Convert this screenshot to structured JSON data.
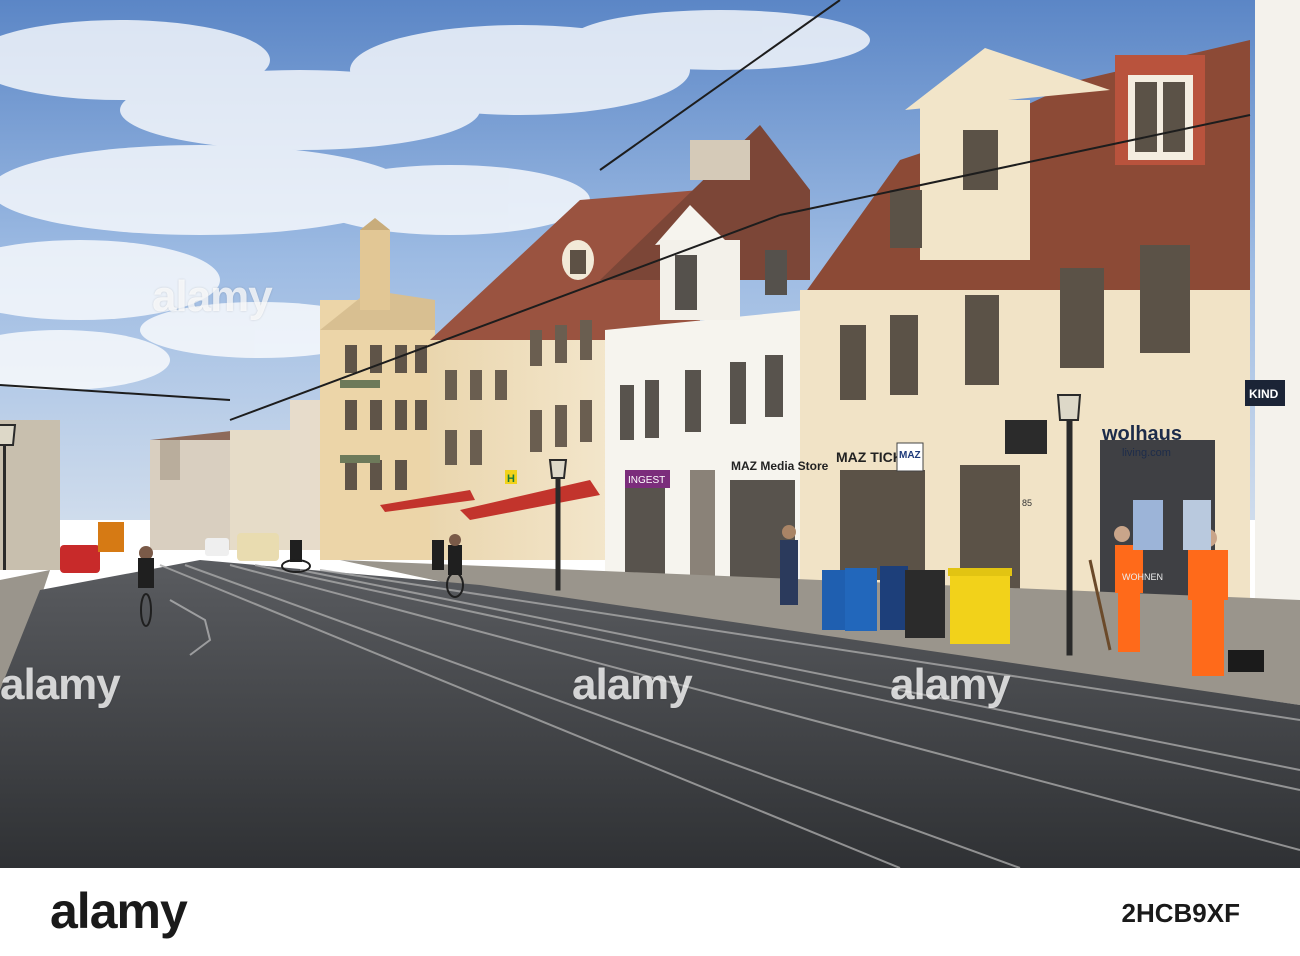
{
  "watermark": {
    "text": "alamy"
  },
  "footer": {
    "logo": "alamy",
    "image_id": "2HCB9XF"
  },
  "signs": {
    "maz_ticket": "MAZ TICKET",
    "maz_media": "MAZ Media Store",
    "maz_small": "MAZ",
    "wolhaus": "wolhaus",
    "wolhaus_sub": "living.com",
    "kind": "KIND",
    "wohnen": "WOHNEN",
    "ingest": "INGEST",
    "h_stop": "H",
    "num_85": "85"
  },
  "colors": {
    "sky": "#8fb3e0",
    "cream_building": "#f1e3c6",
    "white_building": "#f6f4ee",
    "roof": "#8c4a36",
    "road": "#3b3d40",
    "worker_vest": "#ff6a1a",
    "bin_blue": "#1f5fb0",
    "bin_yellow": "#f2d21a"
  }
}
